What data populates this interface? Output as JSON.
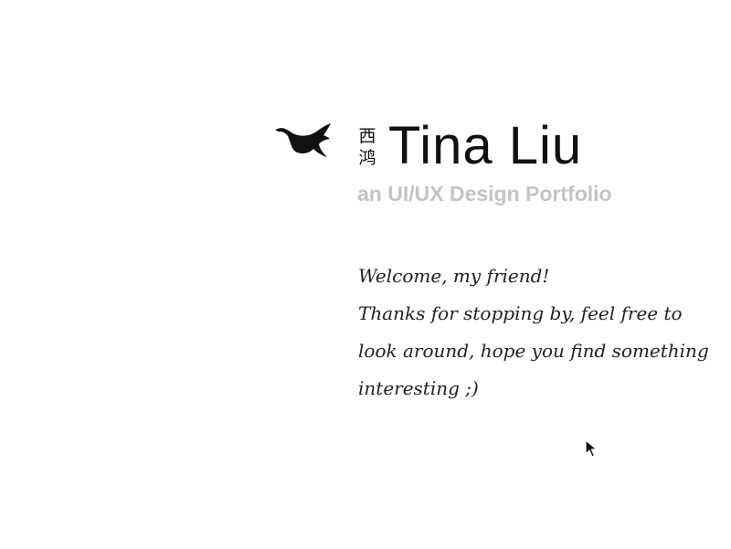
{
  "header": {
    "logo_icon": "flying-goose-icon",
    "chinese_name_chars": [
      "西",
      "鸿"
    ],
    "name": "Tina Liu",
    "subtitle": "an UI/UX Design Portfolio"
  },
  "welcome": {
    "lines": [
      "Welcome, my friend!",
      "Thanks for stopping by, feel free to",
      "look around, hope you find something",
      "interesting ;)"
    ]
  },
  "colors": {
    "text": "#111111",
    "subtitle": "#c4c4c4",
    "background": "#ffffff"
  }
}
